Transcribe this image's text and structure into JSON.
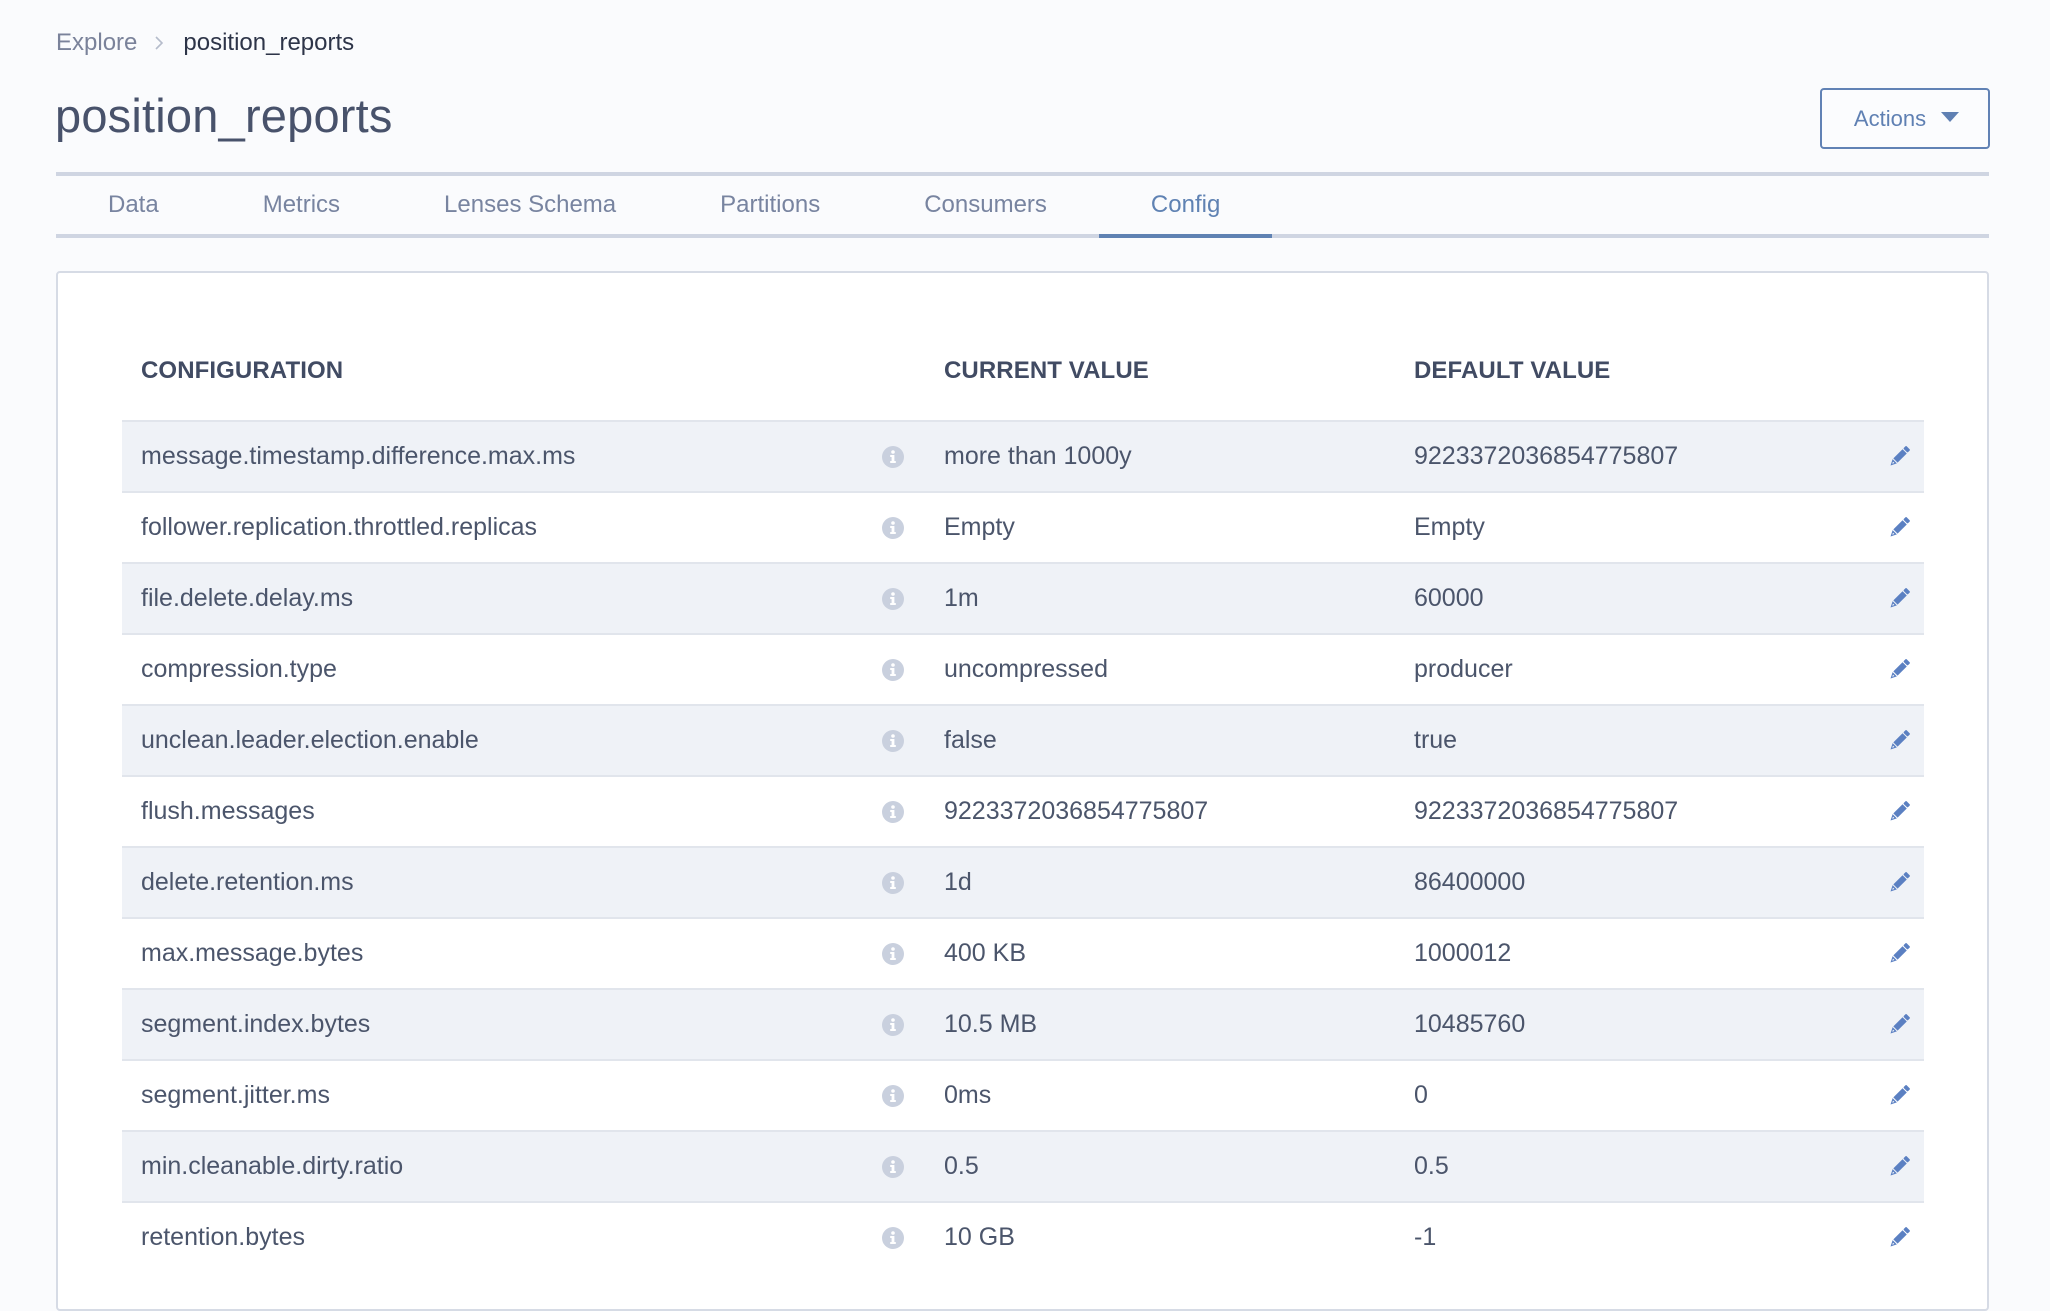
{
  "breadcrumb": {
    "items": [
      {
        "label": "Explore"
      },
      {
        "label": "position_reports"
      }
    ],
    "separator_icon": "chevron-right-icon"
  },
  "header": {
    "title": "position_reports",
    "actions_label": "Actions",
    "actions_icon": "caret-down-icon"
  },
  "tabs": [
    {
      "label": "Data",
      "active": false
    },
    {
      "label": "Metrics",
      "active": false
    },
    {
      "label": "Lenses Schema",
      "active": false
    },
    {
      "label": "Partitions",
      "active": false
    },
    {
      "label": "Consumers",
      "active": false
    },
    {
      "label": "Config",
      "active": true
    }
  ],
  "table": {
    "columns": {
      "configuration": "CONFIGURATION",
      "current_value": "CURRENT VALUE",
      "default_value": "DEFAULT VALUE"
    },
    "row_icons": {
      "info": "info-circle-icon",
      "edit": "pencil-icon"
    },
    "rows": [
      {
        "name": "message.timestamp.difference.max.ms",
        "current": "more than 1000y",
        "default": "9223372036854775807"
      },
      {
        "name": "follower.replication.throttled.replicas",
        "current": "Empty",
        "default": "Empty"
      },
      {
        "name": "file.delete.delay.ms",
        "current": "1m",
        "default": "60000"
      },
      {
        "name": "compression.type",
        "current": "uncompressed",
        "default": "producer"
      },
      {
        "name": "unclean.leader.election.enable",
        "current": "false",
        "default": "true"
      },
      {
        "name": "flush.messages",
        "current": "9223372036854775807",
        "default": "9223372036854775807"
      },
      {
        "name": "delete.retention.ms",
        "current": "1d",
        "default": "86400000"
      },
      {
        "name": "max.message.bytes",
        "current": "400 KB",
        "default": "1000012"
      },
      {
        "name": "segment.index.bytes",
        "current": "10.5 MB",
        "default": "10485760"
      },
      {
        "name": "segment.jitter.ms",
        "current": "0ms",
        "default": "0"
      },
      {
        "name": "min.cleanable.dirty.ratio",
        "current": "0.5",
        "default": "0.5"
      },
      {
        "name": "retention.bytes",
        "current": "10 GB",
        "default": "-1"
      }
    ]
  },
  "colors": {
    "accent": "#5f82b3",
    "icon_blue": "#5b80c2",
    "info_icon": "#c9d0de",
    "row_shade": "#eff2f7",
    "border": "#cfd5e2",
    "text": "#4b556b",
    "background": "#fafbfd"
  }
}
